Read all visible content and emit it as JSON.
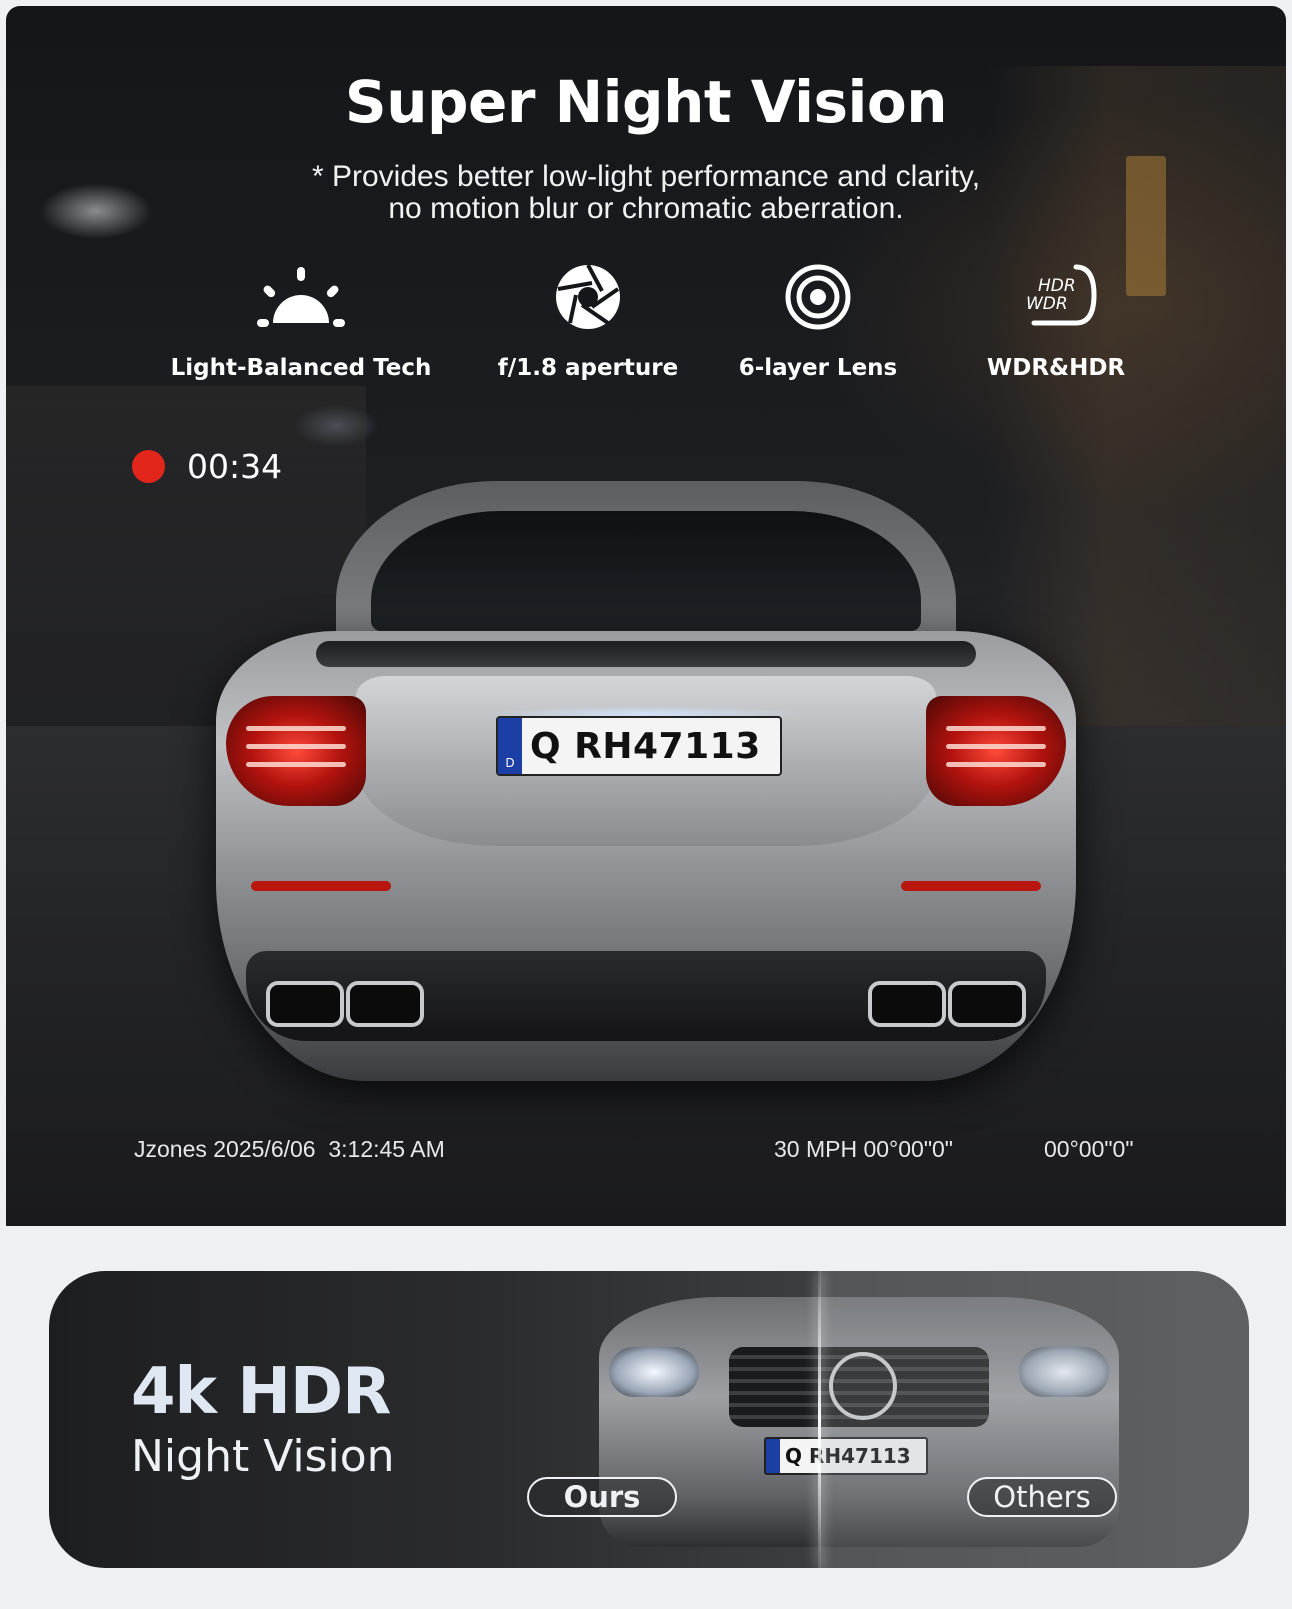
{
  "hero": {
    "title": "Super Night Vision",
    "subtitle_line1": "* Provides better low-light performance and clarity,",
    "subtitle_line2": "no motion blur or chromatic aberration."
  },
  "features": [
    {
      "icon": "sun-icon",
      "label": "Light-Balanced Tech"
    },
    {
      "icon": "aperture-icon",
      "label": "f/1.8 aperture"
    },
    {
      "icon": "lens-icon",
      "label": "6-layer Lens"
    },
    {
      "icon": "hdr-wdr-icon",
      "label": "WDR&HDR",
      "icon_text_top": "HDR",
      "icon_text_bottom": "WDR"
    }
  ],
  "recording": {
    "time": "00:34",
    "dot_color": "#e3261c"
  },
  "car_plate": {
    "country": "D",
    "prefix": "Q",
    "number": "RH47113"
  },
  "dashcam_overlay": {
    "brand_date_time": "Jzones 2025/6/06  3:12:45 AM",
    "speed_coords": "30 MPH 00°00\"0\"",
    "coords": "00°00\"0\""
  },
  "comparison": {
    "heading": "4k HDR",
    "subheading": "Night Vision",
    "plate_prefix": "Q",
    "plate_number": "RH47113",
    "ours_label": "Ours",
    "others_label": "Others"
  }
}
